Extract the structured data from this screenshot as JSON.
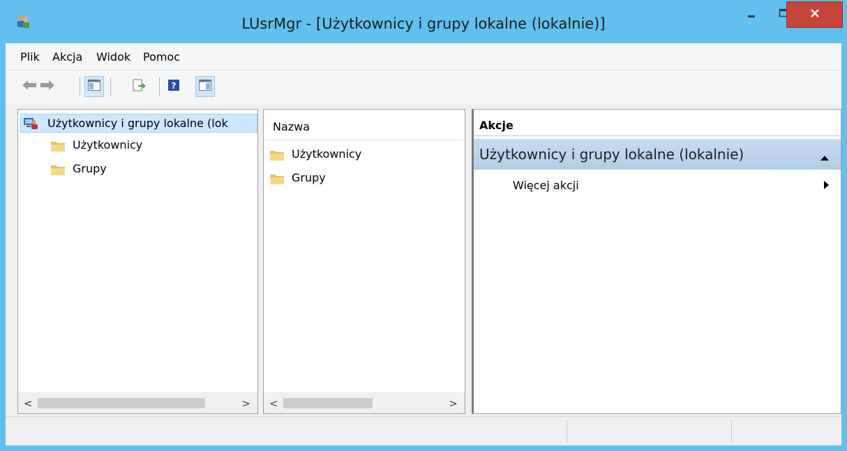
{
  "window": {
    "title": "LUsrMgr - [Użytkownicy i grupy lokalne (lokalnie)]",
    "app_icon": "users-icon",
    "controls": {
      "minimize": "minimize-icon",
      "maximize": "maximize-icon",
      "close": "close-icon"
    },
    "colors": {
      "frame": "#62c0ee",
      "close": "#c6453a",
      "selection": "#cce8ff",
      "actions_section": "#b8d0e8"
    }
  },
  "menu": {
    "items": [
      {
        "label": "Plik"
      },
      {
        "label": "Akcja"
      },
      {
        "label": "Widok"
      },
      {
        "label": "Pomoc"
      }
    ]
  },
  "toolbar": {
    "buttons": [
      {
        "icon": "back-arrow-icon"
      },
      {
        "icon": "forward-arrow-icon"
      },
      {
        "icon": "show-hide-console-tree-icon",
        "active": true
      },
      {
        "icon": "export-list-icon"
      },
      {
        "icon": "help-icon"
      },
      {
        "icon": "show-hide-action-pane-icon",
        "active": true
      }
    ]
  },
  "tree": {
    "root": {
      "label": "Użytkownicy i grupy lokalne (lok",
      "icon": "computer-users-icon"
    },
    "children": [
      {
        "label": "Użytkownicy",
        "icon": "folder-icon"
      },
      {
        "label": "Grupy",
        "icon": "folder-icon"
      }
    ]
  },
  "list": {
    "columns": [
      {
        "label": "Nazwa"
      }
    ],
    "rows": [
      {
        "name": "Użytkownicy",
        "icon": "folder-icon"
      },
      {
        "name": "Grupy",
        "icon": "folder-icon"
      }
    ]
  },
  "actions": {
    "header": "Akcje",
    "section": {
      "label": "Użytkownicy i grupy lokalne (lokalnie)",
      "expanded": true
    },
    "items": [
      {
        "label": "Więcej akcji",
        "has_submenu": true
      }
    ]
  },
  "scrollbars": {
    "left": "<",
    "right": ">"
  }
}
